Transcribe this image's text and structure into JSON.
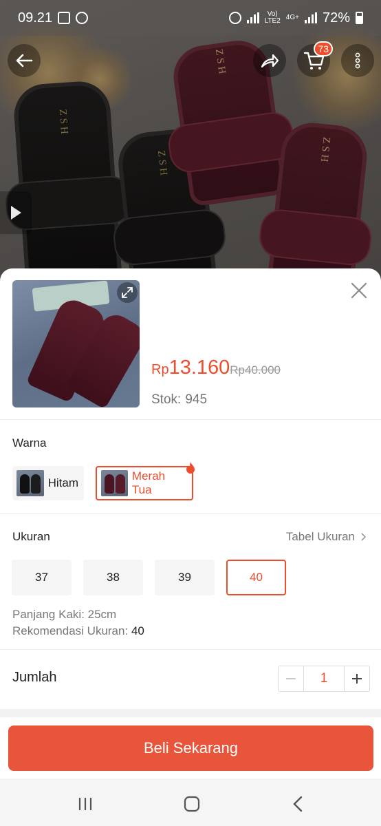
{
  "status_bar": {
    "time": "09.21",
    "net_top": "Vo)",
    "net_bottom": "LTE2",
    "net_type": "4G+",
    "battery": "72%",
    "icons": [
      "gallery-icon",
      "whatsapp-icon",
      "alarm-icon",
      "signal-icon",
      "battery-icon"
    ]
  },
  "header": {
    "cart_badge": "73",
    "icons": [
      "back-arrow-icon",
      "share-icon",
      "cart-icon",
      "more-vertical-icon",
      "play-icon"
    ]
  },
  "hero_brand": "ZSH",
  "product": {
    "price_currency": "Rp",
    "price": "13.160",
    "original_currency": "Rp",
    "original_price": "40.000",
    "stock_label": "Stok:",
    "stock_value": "945"
  },
  "variants": {
    "label": "Warna",
    "options": [
      {
        "label": "Hitam",
        "selected": false
      },
      {
        "label": "Merah Tua",
        "selected": true
      }
    ]
  },
  "sizes": {
    "label": "Ukuran",
    "guide_label": "Tabel Ukuran",
    "options": [
      "37",
      "38",
      "39",
      "40"
    ],
    "selected": "40",
    "foot_length_label": "Panjang Kaki:",
    "foot_length_value": "25cm",
    "recommend_label": "Rekomendasi Ukuran:",
    "recommend_value": "40"
  },
  "quantity": {
    "label": "Jumlah",
    "value": "1"
  },
  "buy_button": "Beli Sekarang",
  "colors": {
    "accent": "#ee4d2d",
    "buy_button": "#e8553a"
  }
}
